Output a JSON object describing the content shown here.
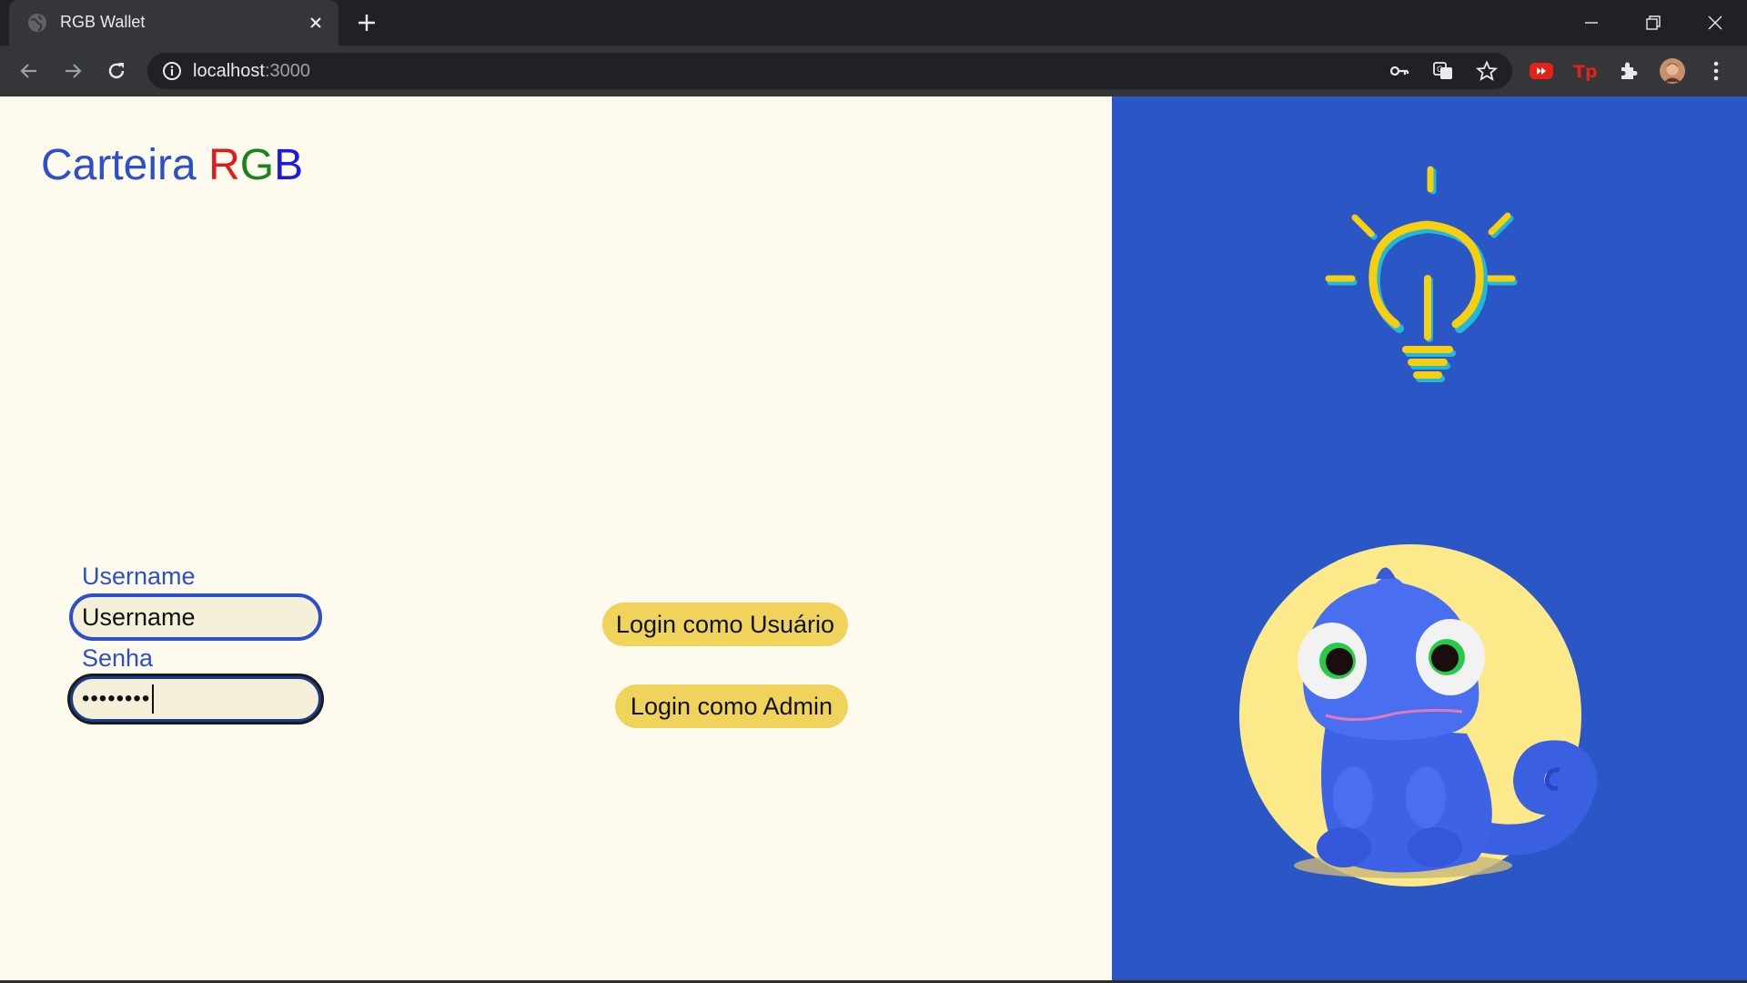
{
  "browser": {
    "tab_title": "RGB Wallet",
    "url_host": "localhost",
    "url_port": ":3000"
  },
  "page": {
    "brand_prefix": "Carteira ",
    "brand_r": "R",
    "brand_g": "G",
    "brand_b": "B",
    "username_label": "Username",
    "username_value": "Username",
    "password_label": "Senha",
    "password_masked": "••••••••",
    "login_user_button": "Login como Usuário",
    "login_admin_button": "Login como Admin"
  },
  "colors": {
    "left_background": "#fffaee",
    "right_background": "#2a56c6",
    "accent_blue": "#2b50c8",
    "button_yellow": "#f0d35a",
    "brand_r": "#e01b1b",
    "brand_g": "#16861a",
    "brand_b": "#1a1ae0"
  },
  "icons": [
    "globe-icon",
    "close-icon",
    "plus-icon",
    "minimize-icon",
    "restore-icon",
    "back-icon",
    "forward-icon",
    "reload-icon",
    "info-icon",
    "key-icon",
    "translate-icon",
    "star-icon",
    "youtube-extension-icon",
    "tp-extension-icon",
    "puzzle-icon",
    "profile-avatar",
    "kebab-menu-icon",
    "lightbulb-illustration",
    "chameleon-illustration"
  ]
}
